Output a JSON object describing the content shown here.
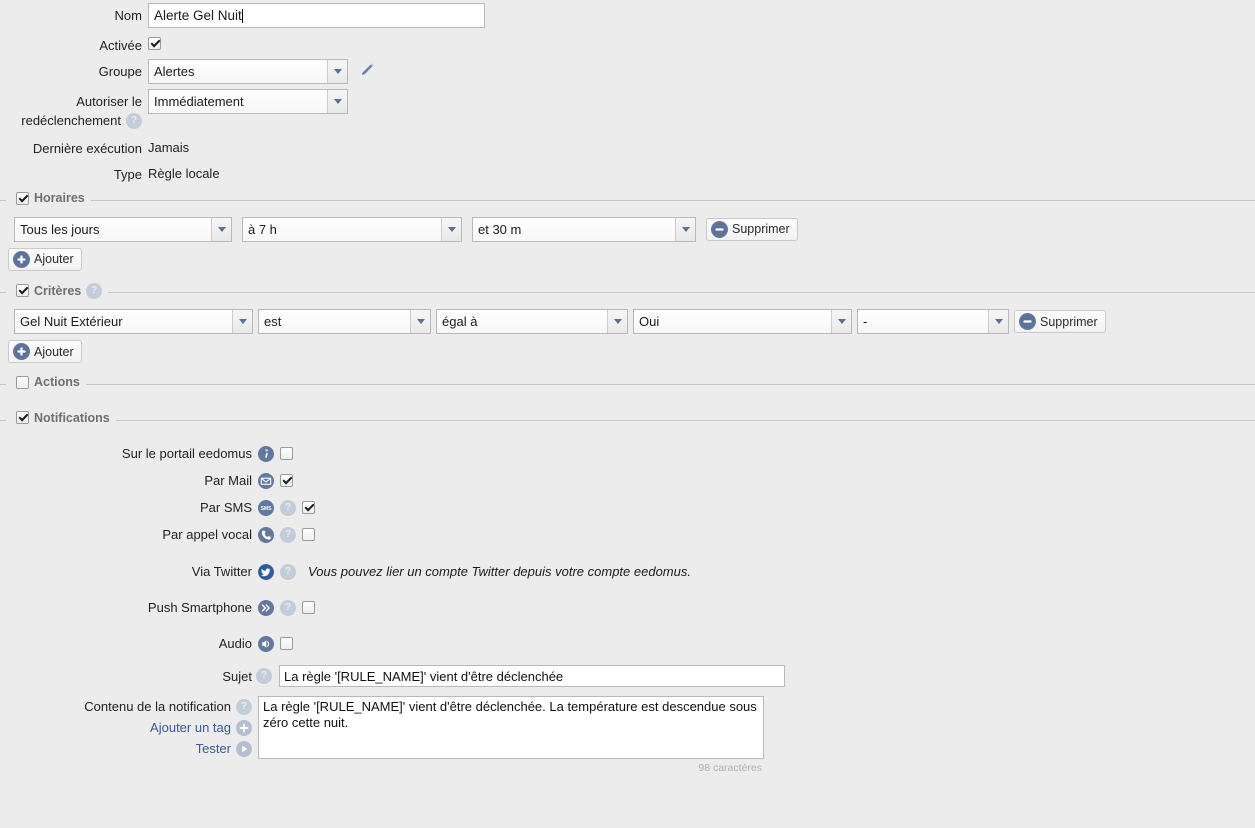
{
  "form": {
    "name": {
      "label": "Nom",
      "value": "Alerte Gel Nuit"
    },
    "enabled": {
      "label": "Activée",
      "checked": true
    },
    "group": {
      "label": "Groupe",
      "value": "Alertes",
      "edit_icon": "pencil-icon"
    },
    "retrigger": {
      "label_line1": "Autoriser le",
      "label_line2": "redéclenchement",
      "value": "Immédiatement",
      "help_icon": "help-icon"
    },
    "last_run": {
      "label": "Dernière exécution",
      "value": "Jamais"
    },
    "type": {
      "label": "Type",
      "value": "Règle locale"
    }
  },
  "schedules": {
    "legend": "Horaires",
    "checked": true,
    "rows": [
      {
        "day": "Tous les jours",
        "hour": "à 7 h",
        "minute": "et 30 m",
        "remove_label": "Supprimer"
      }
    ],
    "add_label": "Ajouter"
  },
  "criteria": {
    "legend": "Critères",
    "checked": true,
    "help_icon": "help-icon",
    "rows": [
      {
        "source": "Gel Nuit Extérieur",
        "verb": "est",
        "operator": "égal à",
        "value": "Oui",
        "extra": "-",
        "remove_label": "Supprimer"
      }
    ],
    "add_label": "Ajouter"
  },
  "actions": {
    "legend": "Actions",
    "checked": false
  },
  "notifications": {
    "legend": "Notifications",
    "checked": true,
    "rows": [
      {
        "label": "Sur le portail eedomus",
        "icon": "info-icon",
        "help": false,
        "checked": false
      },
      {
        "label": "Par Mail",
        "icon": "mail-icon",
        "help": false,
        "checked": true
      },
      {
        "label": "Par SMS",
        "icon": "sms-icon",
        "help": true,
        "checked": true
      },
      {
        "label": "Par appel vocal",
        "icon": "phone-icon",
        "help": true,
        "checked": false
      },
      {
        "label": "Via Twitter",
        "icon": "twitter-icon",
        "help": true,
        "note": "Vous pouvez lier un compte Twitter depuis votre compte eedomus."
      },
      {
        "label": "Push Smartphone",
        "icon": "push-icon",
        "help": true,
        "checked": false
      },
      {
        "label": "Audio",
        "icon": "audio-icon",
        "help": false,
        "checked": false
      }
    ],
    "subject": {
      "label": "Sujet",
      "help_icon": "help-icon",
      "value": "La règle '[RULE_NAME]' vient d'être déclenchée"
    },
    "content": {
      "label": "Contenu de la notification",
      "help_icon": "help-icon",
      "value": "La règle '[RULE_NAME]' vient d'être déclenchée. La température est descendue sous zéro cette nuit.",
      "add_tag_label": "Ajouter un tag",
      "test_label": "Tester",
      "char_count": "98 caractères"
    }
  },
  "colors": {
    "background": "#ececec",
    "icon_blue": "#62789e",
    "icon_pale": "#c3ccd9",
    "link": "#3a5a9b",
    "legend_text": "#6f6f6f"
  }
}
